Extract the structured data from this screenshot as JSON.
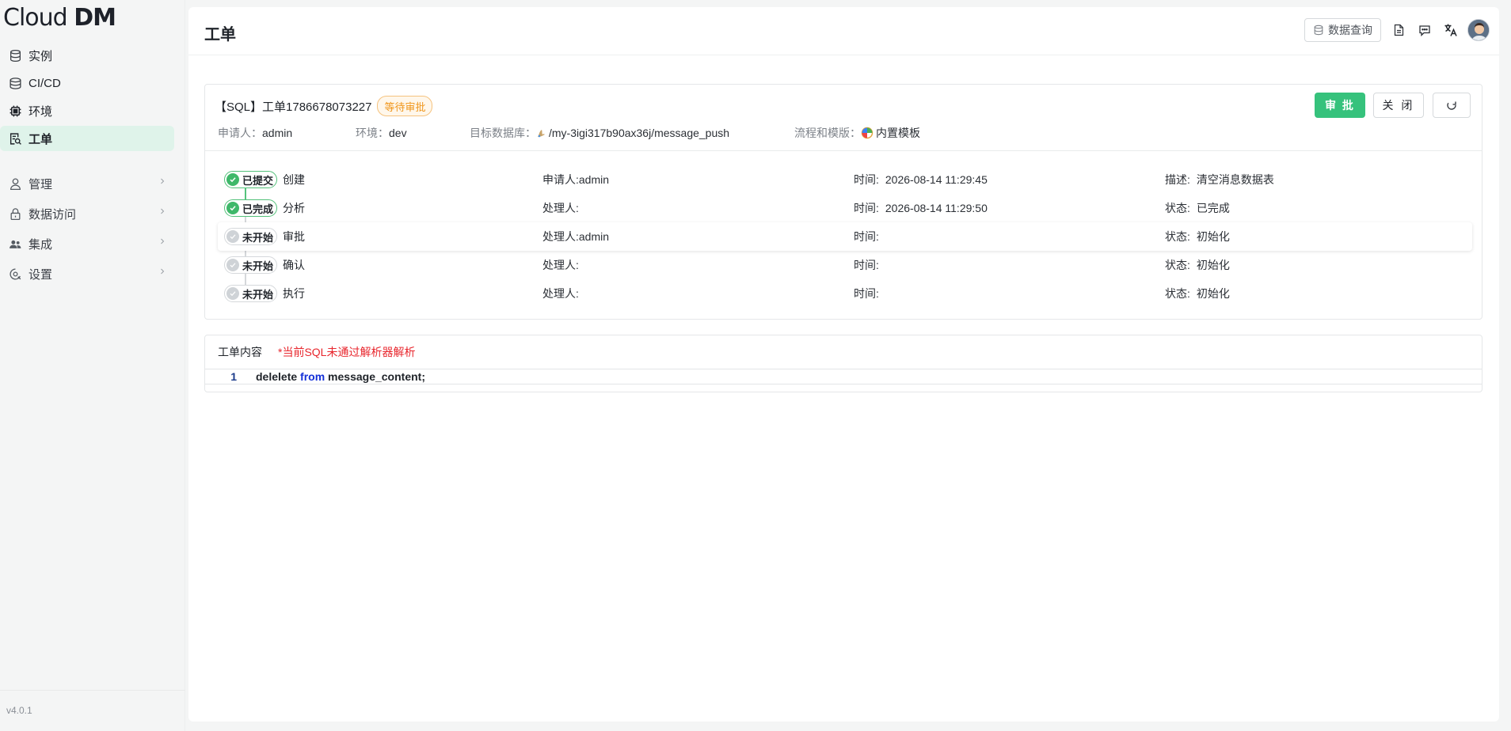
{
  "brand": {
    "logo_text": "Cloud DM"
  },
  "sidebar": {
    "items": [
      {
        "label": "实例",
        "icon": "database-icon"
      },
      {
        "label": "CI/CD",
        "icon": "stack-icon"
      },
      {
        "label": "环境",
        "icon": "chip-icon"
      },
      {
        "label": "工单",
        "icon": "ticket-search-icon",
        "active": true
      }
    ],
    "groups": [
      {
        "label": "管理",
        "icon": "user-icon"
      },
      {
        "label": "数据访问",
        "icon": "lock-icon"
      },
      {
        "label": "集成",
        "icon": "users-icon"
      },
      {
        "label": "设置",
        "icon": "settings-icon"
      }
    ],
    "version": "v4.0.1"
  },
  "header": {
    "title": "工单",
    "query_button": "数据查询"
  },
  "ticket": {
    "title": "【SQL】工单1786678073227",
    "status_tag": "等待审批",
    "applicant_label": "申请人：",
    "applicant": "admin",
    "env_label": "环境：",
    "env": "dev",
    "target_label": "目标数据库：",
    "target": "/my-3igi317b90ax36j/message_push",
    "flow_label": "流程和模版：",
    "flow": "内置模板",
    "approve_button": "审 批",
    "close_button": "关 闭"
  },
  "steps": [
    {
      "badge": "已提交",
      "name": "创建",
      "c2": "申请人:admin",
      "c3_label": "时间:",
      "c3": "2026-08-14 11:29:45",
      "c4_label": "描述:",
      "c4": "清空消息数据表",
      "state": "done"
    },
    {
      "badge": "已完成",
      "name": "分析",
      "c2": "处理人:",
      "c3_label": "时间:",
      "c3": "2026-08-14 11:29:50",
      "c4_label": "状态:",
      "c4": "已完成",
      "state": "done"
    },
    {
      "badge": "未开始",
      "name": "审批",
      "c2": "处理人:admin",
      "c3_label": "时间:",
      "c3": "",
      "c4_label": "状态:",
      "c4": "初始化",
      "state": "todo"
    },
    {
      "badge": "未开始",
      "name": "确认",
      "c2": "处理人:",
      "c3_label": "时间:",
      "c3": "",
      "c4_label": "状态:",
      "c4": "初始化",
      "state": "todo"
    },
    {
      "badge": "未开始",
      "name": "执行",
      "c2": "处理人:",
      "c3_label": "时间:",
      "c3": "",
      "c4_label": "状态:",
      "c4": "初始化",
      "state": "todo"
    }
  ],
  "content": {
    "label": "工单内容",
    "warning": "*当前SQL未通过解析器解析",
    "line_number": "1",
    "code_pre": "delelete ",
    "code_kw": "from",
    "code_post": " message_content;"
  },
  "colors": {
    "accent": "#36c27c",
    "warning": "#f0961b",
    "error": "#e8262d"
  }
}
